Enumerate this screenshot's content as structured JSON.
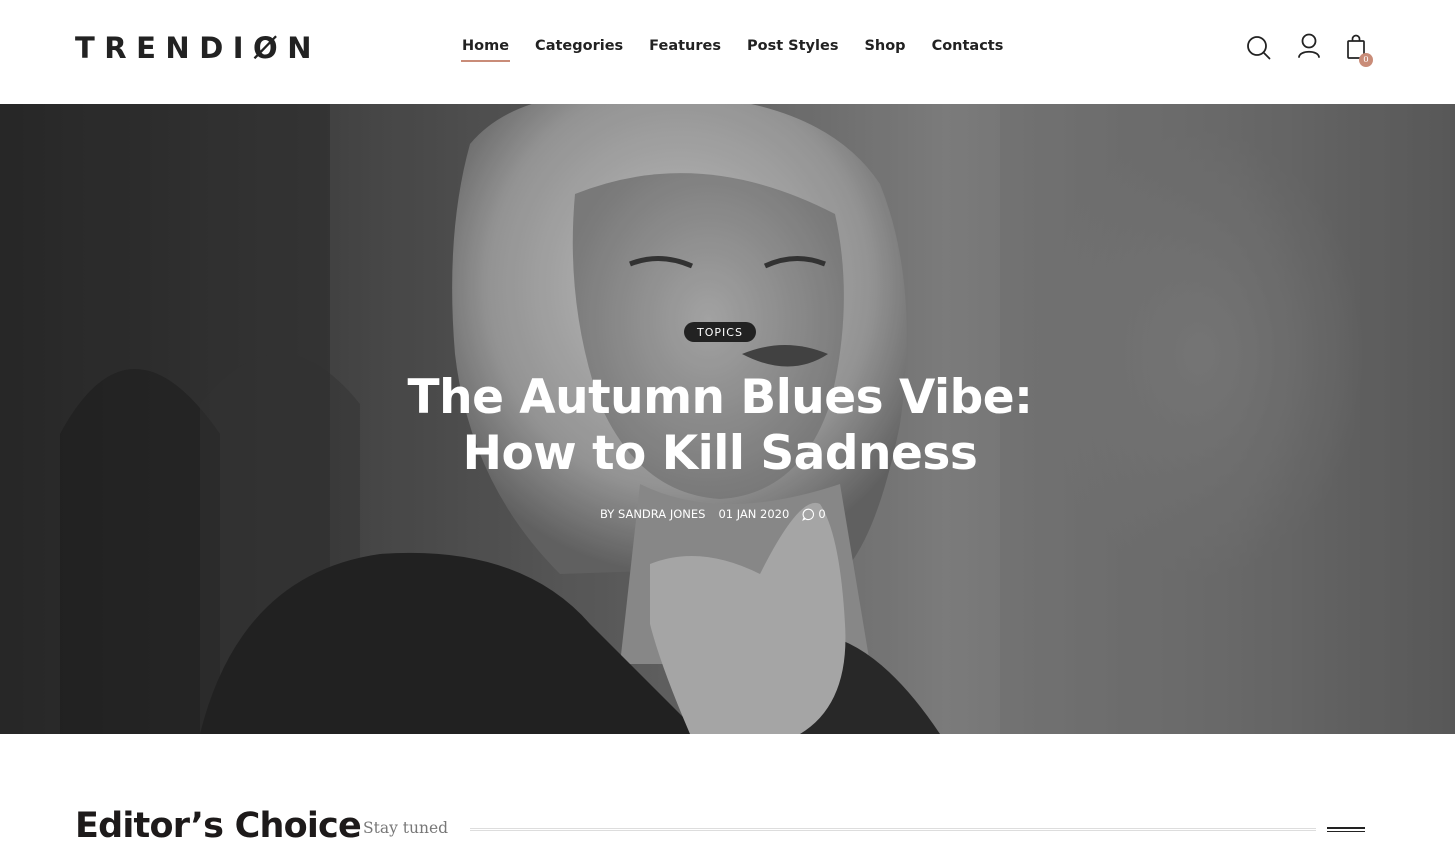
{
  "header": {
    "logo_text": "TRENDIØN",
    "nav": [
      {
        "label": "Home",
        "active": true
      },
      {
        "label": "Categories"
      },
      {
        "label": "Features"
      },
      {
        "label": "Post Styles"
      },
      {
        "label": "Shop"
      },
      {
        "label": "Contacts"
      }
    ],
    "icons": [
      "search-icon",
      "user-icon",
      "shopping-bag-icon"
    ],
    "cart_count": "0"
  },
  "hero": {
    "badge": "TOPICS",
    "title_line1": "The Autumn Blues Vibe:",
    "title_line2": "How to Kill Sadness",
    "author": "BY SANDRA JONES",
    "date": "01 JAN 2020",
    "comments": "0"
  },
  "section": {
    "title": "Editor’s Choice",
    "subtitle": "Stay tuned"
  },
  "colors": {
    "accent": "#c98c78",
    "text": "#1d1a1a"
  }
}
